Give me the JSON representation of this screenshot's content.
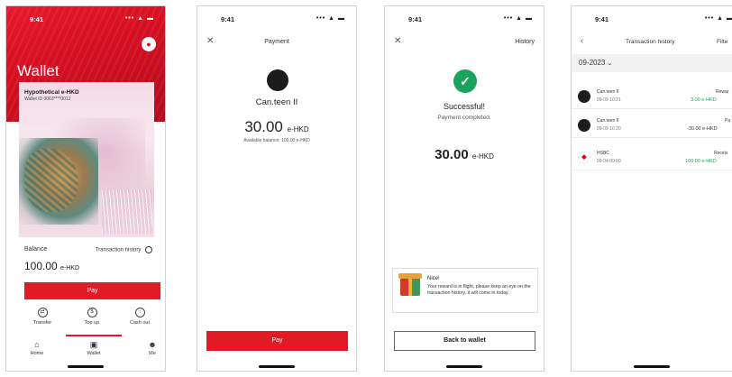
{
  "status_time": "9:41",
  "status_icons": "∵ ▬",
  "colors": {
    "brand_red": "#e01b24",
    "success_green": "#1aa35c",
    "hsbc_red": "#db0011"
  },
  "wallet_screen": {
    "title": "Wallet",
    "card_name": "Hypothetical e-HKD",
    "wallet_id": "Wallet ID 0003****0012",
    "balance_label": "Balance",
    "transaction_history_link": "Transaction history",
    "balance_value": "100.00",
    "currency": "e-HKD",
    "pay_label": "Pay",
    "actions": [
      {
        "label": "Transfer",
        "icon": "transfer-icon"
      },
      {
        "label": "Top up",
        "icon": "top-up-icon"
      },
      {
        "label": "Cash out",
        "icon": "cash-out-icon"
      }
    ],
    "tabs": [
      {
        "label": "Home",
        "icon": "home-icon"
      },
      {
        "label": "Wallet",
        "icon": "wallet-icon",
        "active": true
      },
      {
        "label": "Me",
        "icon": "user-icon"
      }
    ]
  },
  "payment_screen": {
    "title": "Payment",
    "merchant": "Can.teen II",
    "amount": "30.00",
    "currency": "e-HKD",
    "available_balance": "Available balance: 100.00 e-HKD",
    "pay_label": "Pay"
  },
  "success_screen": {
    "history_label": "History",
    "headline": "Successful!",
    "subtitle": "Payment completed.",
    "amount": "30.00",
    "currency": "e-HKD",
    "reward_title": "Nice!",
    "reward_text": "Your reward is in flight, please keep an eye on the transaction history, it will come in today.",
    "back_label": "Back to wallet"
  },
  "history_screen": {
    "title": "Transaction history",
    "filter_label": "Filte",
    "month": "09-2023",
    "transactions": [
      {
        "name": "Can.teen II",
        "date": "09-09 10:21",
        "type": "Rewar",
        "amount": "3.00 e-HKD",
        "sign": "pos"
      },
      {
        "name": "Can.teen II",
        "date": "09-09 10:20",
        "type": "Pa",
        "amount": "-30.00 e-HKD",
        "sign": "neg"
      },
      {
        "name": "HSBC",
        "date": "09-04 09:00",
        "type": "Receiv",
        "amount": "100.00 e-HKD",
        "sign": "pos"
      }
    ]
  }
}
